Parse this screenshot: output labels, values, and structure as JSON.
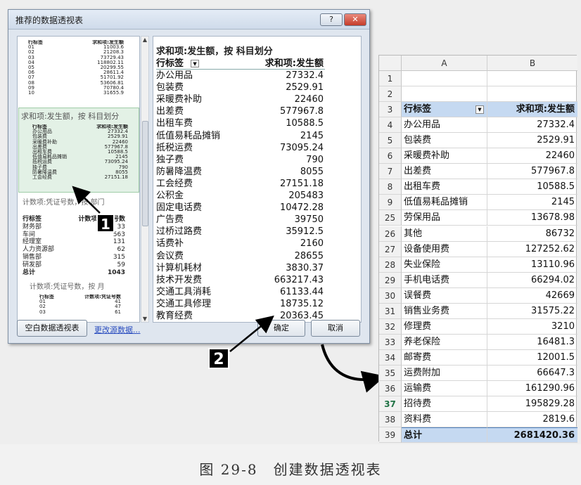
{
  "dialog": {
    "title": "推荐的数据透视表",
    "help_label": "?",
    "close_label": "✕",
    "blank_pivot_button": "空白数据透视表",
    "change_source_link": "更改源数据...",
    "ok_button": "确定",
    "cancel_button": "取消",
    "thumb1": {
      "header": [
        "行标签",
        "求和项:发生额"
      ],
      "rows": [
        [
          "01",
          "11003.6"
        ],
        [
          "02",
          "21208.3"
        ],
        [
          "03",
          "73729.43"
        ],
        [
          "04",
          "118802.11"
        ],
        [
          "05",
          "20299.55"
        ],
        [
          "06",
          "28611.4"
        ],
        [
          "07",
          "51701.92"
        ],
        [
          "08",
          "53606.81"
        ],
        [
          "09",
          "70780.4"
        ],
        [
          "10",
          "31655.9"
        ]
      ]
    },
    "thumb2": {
      "label": "求和项:发生额，按 科目划分",
      "header": [
        "行标签",
        "求和项:发生额"
      ],
      "rows": [
        [
          "办公用品",
          "27332.4"
        ],
        [
          "包装费",
          "2529.91"
        ],
        [
          "采暖费补助",
          "22460"
        ],
        [
          "出差费",
          "577967.8"
        ],
        [
          "出租车费",
          "10588.5"
        ],
        [
          "低值易耗品摊销",
          "2145"
        ],
        [
          "抵税运费",
          "73095.24"
        ],
        [
          "独子费",
          "790"
        ],
        [
          "防暑降温费",
          "8055"
        ],
        [
          "工会经费",
          "27151.18"
        ]
      ]
    },
    "thumb3": {
      "label": "计数项:凭证号数，按 部门",
      "header": [
        "行标签",
        "计数项:凭证号数"
      ],
      "rows": [
        [
          "财务部",
          "33"
        ],
        [
          "车间",
          "563"
        ],
        [
          "经理室",
          "131"
        ],
        [
          "人力资源部",
          "62"
        ],
        [
          "销售部",
          "315"
        ],
        [
          "研发部",
          "59"
        ]
      ],
      "total": [
        "总计",
        "1043"
      ]
    },
    "thumb4": {
      "label": "计数项:凭证号数，按 月",
      "header": [
        "行标签",
        "计数项:凭证号数"
      ],
      "rows": [
        [
          "01",
          "41"
        ],
        [
          "02",
          "47"
        ],
        [
          "03",
          "61"
        ]
      ]
    },
    "preview": {
      "title": "求和项:发生额，按 科目划分",
      "header": [
        "行标签",
        "求和项:发生额"
      ],
      "rows": [
        [
          "办公用品",
          "27332.4"
        ],
        [
          "包装费",
          "2529.91"
        ],
        [
          "采暖费补助",
          "22460"
        ],
        [
          "出差费",
          "577967.8"
        ],
        [
          "出租车费",
          "10588.5"
        ],
        [
          "低值易耗品摊销",
          "2145"
        ],
        [
          "抵税运费",
          "73095.24"
        ],
        [
          "独子费",
          "790"
        ],
        [
          "防暑降温费",
          "8055"
        ],
        [
          "工会经费",
          "27151.18"
        ],
        [
          "公积金",
          "205483"
        ],
        [
          "固定电话费",
          "10472.28"
        ],
        [
          "广告费",
          "39750"
        ],
        [
          "过桥过路费",
          "35912.5"
        ],
        [
          "话费补",
          "2160"
        ],
        [
          "会议费",
          "28655"
        ],
        [
          "计算机耗材",
          "3830.37"
        ],
        [
          "技术开发费",
          "663217.43"
        ],
        [
          "交通工具消耗",
          "61133.44"
        ],
        [
          "交通工具修理",
          "18735.12"
        ],
        [
          "教育经费",
          "20363.45"
        ]
      ]
    }
  },
  "badges": {
    "one": "1",
    "two": "2"
  },
  "sheet": {
    "columns": [
      "A",
      "B"
    ],
    "rows": [
      {
        "n": "1",
        "a": "",
        "b": ""
      },
      {
        "n": "2",
        "a": "",
        "b": ""
      },
      {
        "n": "3",
        "a": "行标签",
        "b": "求和项:发生额"
      },
      {
        "n": "4",
        "a": "办公用品",
        "b": "27332.4"
      },
      {
        "n": "5",
        "a": "包装费",
        "b": "2529.91"
      },
      {
        "n": "6",
        "a": "采暖费补助",
        "b": "22460"
      },
      {
        "n": "7",
        "a": "出差费",
        "b": "577967.8"
      },
      {
        "n": "8",
        "a": "出租车费",
        "b": "10588.5"
      },
      {
        "n": "9",
        "a": "低值易耗品摊销",
        "b": "2145"
      },
      {
        "n": "25",
        "a": "劳保用品",
        "b": "13678.98"
      },
      {
        "n": "26",
        "a": "其他",
        "b": "86732"
      },
      {
        "n": "27",
        "a": "设备使用费",
        "b": "127252.62"
      },
      {
        "n": "28",
        "a": "失业保险",
        "b": "13110.96"
      },
      {
        "n": "29",
        "a": "手机电话费",
        "b": "66294.02"
      },
      {
        "n": "30",
        "a": "误餐费",
        "b": "42669"
      },
      {
        "n": "31",
        "a": "销售业务费",
        "b": "31575.22"
      },
      {
        "n": "32",
        "a": "修理费",
        "b": "3210"
      },
      {
        "n": "33",
        "a": "养老保险",
        "b": "16481.3"
      },
      {
        "n": "34",
        "a": "邮寄费",
        "b": "12001.5"
      },
      {
        "n": "35",
        "a": "运费附加",
        "b": "66647.3"
      },
      {
        "n": "36",
        "a": "运输费",
        "b": "161290.96"
      },
      {
        "n": "37",
        "a": "招待费",
        "b": "195829.28"
      },
      {
        "n": "38",
        "a": "资料费",
        "b": "2819.6"
      },
      {
        "n": "39",
        "a": "总计",
        "b": "2681420.36"
      }
    ]
  },
  "caption": "图 29-8　创建数据透视表"
}
